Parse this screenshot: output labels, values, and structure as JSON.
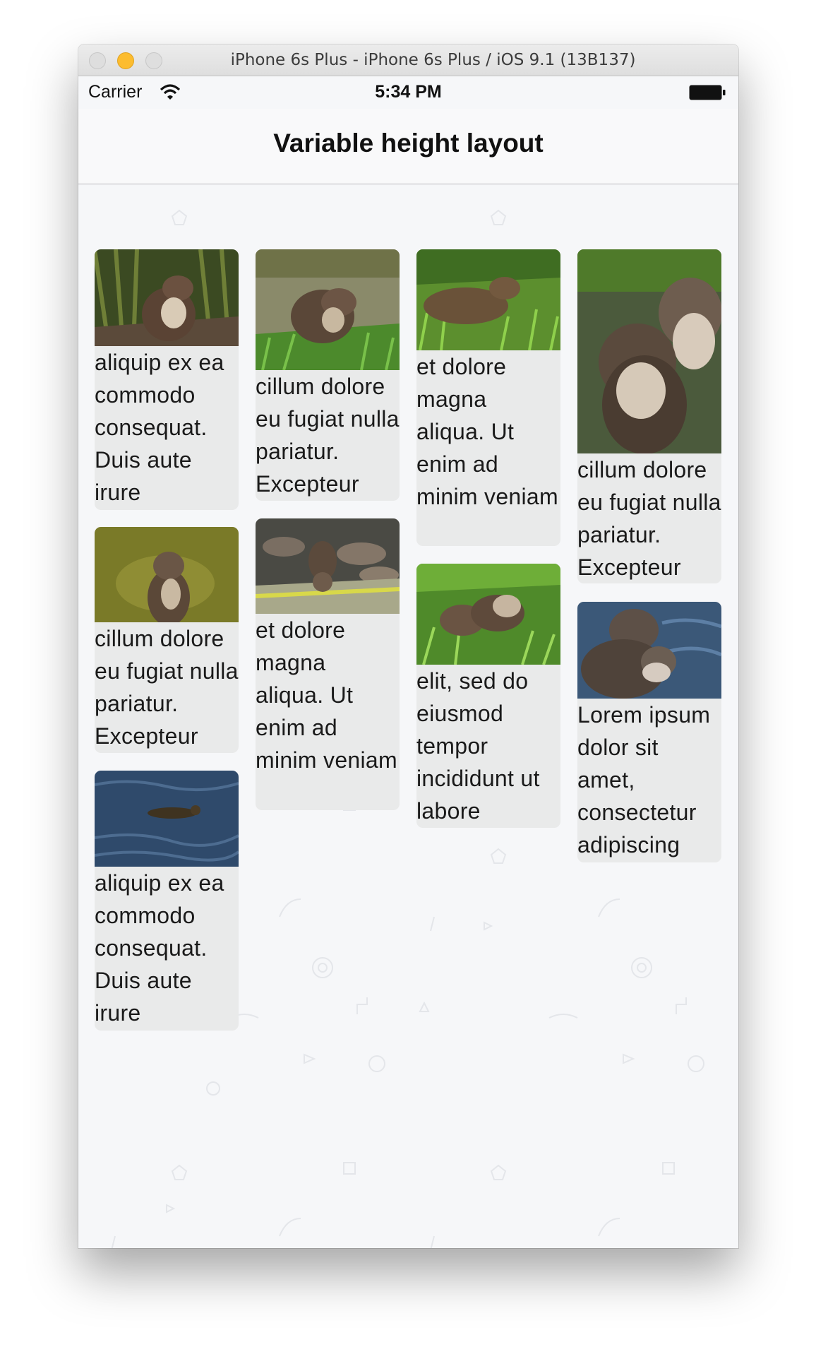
{
  "window": {
    "title": "iPhone 6s Plus - iPhone 6s Plus / iOS 9.1 (13B137)"
  },
  "status_bar": {
    "carrier": "Carrier",
    "time": "5:34 PM"
  },
  "nav": {
    "title": "Variable height layout"
  },
  "cards": [
    {
      "caption": "aliquip ex ea commodo consequat. Duis aute irure",
      "image": "otter-on-log"
    },
    {
      "caption": "cillum dolore eu fugiat nulla pariatur. Excepteur",
      "image": "otter-in-grass-by-water"
    },
    {
      "caption": "et dolore magna aliqua. Ut enim ad minim veniam",
      "image": "otter-in-tall-grass"
    },
    {
      "caption": "cillum dolore eu fugiat nulla pariatur. Excepteur",
      "image": "two-otters-closeup"
    },
    {
      "caption": "cillum dolore eu fugiat nulla pariatur. Excepteur",
      "image": "otter-standing"
    },
    {
      "caption": "et dolore magna aliqua. Ut enim ad minim veniam",
      "image": "otters-on-rocks"
    },
    {
      "caption": "elit, sed do eiusmod tempor incididunt ut labore",
      "image": "two-otters-in-grass"
    },
    {
      "caption": "Lorem ipsum dolor sit amet, consectetur adipiscing",
      "image": "two-otters-by-water"
    },
    {
      "caption": "aliquip ex ea commodo consequat. Duis aute irure",
      "image": "otter-swimming"
    }
  ]
}
